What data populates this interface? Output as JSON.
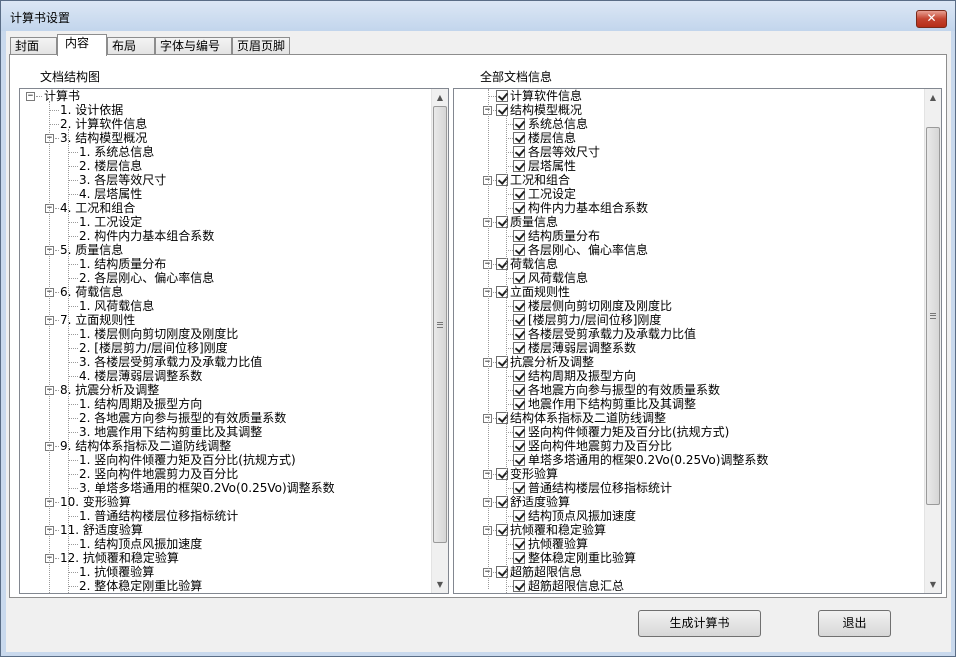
{
  "window": {
    "title": "计算书设置",
    "close_glyph": "✕"
  },
  "tabs": [
    {
      "label": "封面",
      "active": false
    },
    {
      "label": "内容",
      "active": true
    },
    {
      "label": "布局",
      "active": false
    },
    {
      "label": "字体与编号",
      "active": false
    },
    {
      "label": "页眉页脚",
      "active": false
    }
  ],
  "left_panel": {
    "title": "文档结构图",
    "root": "计算书",
    "items": [
      {
        "level": 1,
        "label": "1. 设计依据",
        "expandable": false
      },
      {
        "level": 1,
        "label": "2. 计算软件信息",
        "expandable": false
      },
      {
        "level": 1,
        "label": "3. 结构模型概况",
        "expandable": true
      },
      {
        "level": 2,
        "label": "1. 系统总信息"
      },
      {
        "level": 2,
        "label": "2. 楼层信息"
      },
      {
        "level": 2,
        "label": "3. 各层等效尺寸"
      },
      {
        "level": 2,
        "label": "4. 层塔属性"
      },
      {
        "level": 1,
        "label": "4. 工况和组合",
        "expandable": true
      },
      {
        "level": 2,
        "label": "1. 工况设定"
      },
      {
        "level": 2,
        "label": "2. 构件内力基本组合系数"
      },
      {
        "level": 1,
        "label": "5. 质量信息",
        "expandable": true
      },
      {
        "level": 2,
        "label": "1. 结构质量分布"
      },
      {
        "level": 2,
        "label": "2. 各层刚心、偏心率信息"
      },
      {
        "level": 1,
        "label": "6. 荷载信息",
        "expandable": true
      },
      {
        "level": 2,
        "label": "1. 风荷载信息"
      },
      {
        "level": 1,
        "label": "7. 立面规则性",
        "expandable": true
      },
      {
        "level": 2,
        "label": "1. 楼层侧向剪切刚度及刚度比"
      },
      {
        "level": 2,
        "label": "2. [楼层剪力/层间位移]刚度"
      },
      {
        "level": 2,
        "label": "3. 各楼层受剪承载力及承载力比值"
      },
      {
        "level": 2,
        "label": "4. 楼层薄弱层调整系数"
      },
      {
        "level": 1,
        "label": "8. 抗震分析及调整",
        "expandable": true
      },
      {
        "level": 2,
        "label": "1. 结构周期及振型方向"
      },
      {
        "level": 2,
        "label": "2. 各地震方向参与振型的有效质量系数"
      },
      {
        "level": 2,
        "label": "3. 地震作用下结构剪重比及其调整"
      },
      {
        "level": 1,
        "label": "9. 结构体系指标及二道防线调整",
        "expandable": true
      },
      {
        "level": 2,
        "label": "1. 竖向构件倾覆力矩及百分比(抗规方式)"
      },
      {
        "level": 2,
        "label": "2. 竖向构件地震剪力及百分比"
      },
      {
        "level": 2,
        "label": "3. 单塔多塔通用的框架0.2Vo(0.25Vo)调整系数"
      },
      {
        "level": 1,
        "label": "10. 变形验算",
        "expandable": true
      },
      {
        "level": 2,
        "label": "1. 普通结构楼层位移指标统计"
      },
      {
        "level": 1,
        "label": "11. 舒适度验算",
        "expandable": true
      },
      {
        "level": 2,
        "label": "1. 结构顶点风振加速度"
      },
      {
        "level": 1,
        "label": "12. 抗倾覆和稳定验算",
        "expandable": true
      },
      {
        "level": 2,
        "label": "1. 抗倾覆验算"
      },
      {
        "level": 2,
        "label": "2. 整体稳定刚重比验算"
      }
    ]
  },
  "right_panel": {
    "title": "全部文档信息",
    "items": [
      {
        "level": 1,
        "label": "计算软件信息",
        "expandable": false
      },
      {
        "level": 1,
        "label": "结构模型概况",
        "expandable": true
      },
      {
        "level": 2,
        "label": "系统总信息"
      },
      {
        "level": 2,
        "label": "楼层信息"
      },
      {
        "level": 2,
        "label": "各层等效尺寸"
      },
      {
        "level": 2,
        "label": "层塔属性"
      },
      {
        "level": 1,
        "label": "工况和组合",
        "expandable": true
      },
      {
        "level": 2,
        "label": "工况设定"
      },
      {
        "level": 2,
        "label": "构件内力基本组合系数"
      },
      {
        "level": 1,
        "label": "质量信息",
        "expandable": true
      },
      {
        "level": 2,
        "label": "结构质量分布"
      },
      {
        "level": 2,
        "label": "各层刚心、偏心率信息"
      },
      {
        "level": 1,
        "label": "荷载信息",
        "expandable": true
      },
      {
        "level": 2,
        "label": "风荷载信息"
      },
      {
        "level": 1,
        "label": "立面规则性",
        "expandable": true
      },
      {
        "level": 2,
        "label": "楼层侧向剪切刚度及刚度比"
      },
      {
        "level": 2,
        "label": "[楼层剪力/层间位移]刚度"
      },
      {
        "level": 2,
        "label": "各楼层受剪承载力及承载力比值"
      },
      {
        "level": 2,
        "label": "楼层薄弱层调整系数"
      },
      {
        "level": 1,
        "label": "抗震分析及调整",
        "expandable": true
      },
      {
        "level": 2,
        "label": "结构周期及振型方向"
      },
      {
        "level": 2,
        "label": "各地震方向参与振型的有效质量系数"
      },
      {
        "level": 2,
        "label": "地震作用下结构剪重比及其调整"
      },
      {
        "level": 1,
        "label": "结构体系指标及二道防线调整",
        "expandable": true
      },
      {
        "level": 2,
        "label": "竖向构件倾覆力矩及百分比(抗规方式)"
      },
      {
        "level": 2,
        "label": "竖向构件地震剪力及百分比"
      },
      {
        "level": 2,
        "label": "单塔多塔通用的框架0.2Vo(0.25Vo)调整系数"
      },
      {
        "level": 1,
        "label": "变形验算",
        "expandable": true
      },
      {
        "level": 2,
        "label": "普通结构楼层位移指标统计"
      },
      {
        "level": 1,
        "label": "舒适度验算",
        "expandable": true
      },
      {
        "level": 2,
        "label": "结构顶点风振加速度"
      },
      {
        "level": 1,
        "label": "抗倾覆和稳定验算",
        "expandable": true
      },
      {
        "level": 2,
        "label": "抗倾覆验算"
      },
      {
        "level": 2,
        "label": "整体稳定刚重比验算"
      },
      {
        "level": 1,
        "label": "超筋超限信息",
        "expandable": true
      },
      {
        "level": 2,
        "label": "超筋超限信息汇总"
      }
    ]
  },
  "buttons": {
    "generate": "生成计算书",
    "exit": "退出"
  },
  "icons": {
    "expanded_glyph": "−",
    "scroll_up": "▲",
    "scroll_down": "▼"
  }
}
